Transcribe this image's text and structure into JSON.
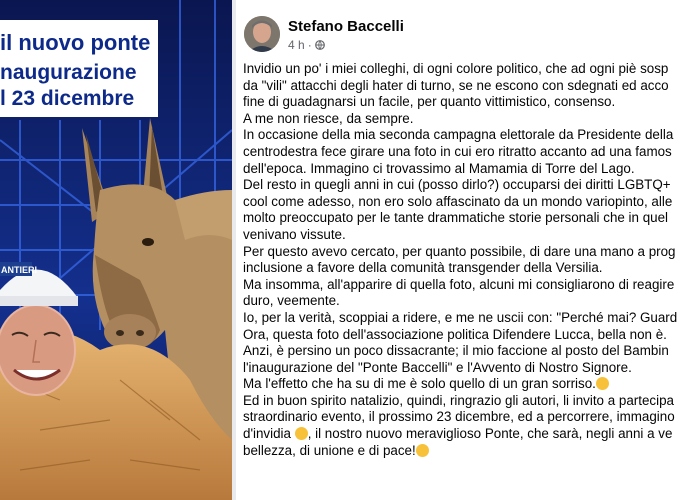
{
  "image": {
    "banner_lines": [
      "il nuovo ponte",
      "naugurazione",
      "l 23 dicembre"
    ],
    "helmet_text": "ANTIERI"
  },
  "post": {
    "author": "Stefano Baccelli",
    "time": "4 h",
    "privacy_icon": "globe-icon",
    "lines": [
      "Invidio un po' i miei colleghi, di ogni colore politico, che ad ogni piè sosp",
      "da \"vili\" attacchi degli hater di turno, se ne escono con sdegnati ed acco",
      "fine di guadagnarsi un facile, per quanto vittimistico, consenso.",
      "A me non riesce, da sempre.",
      "In occasione della mia seconda campagna elettorale da Presidente della",
      "centrodestra fece girare una foto in cui ero ritratto accanto ad una famos",
      "dell'epoca.  Immagino ci trovassimo al Mamamia di Torre del Lago.",
      "Del resto in quegli anni in cui (posso dirlo?) occuparsi dei diritti LGBTQ+",
      "cool come adesso, non ero solo affascinato da un mondo variopinto, alle",
      "molto preoccupato per le tante drammatiche storie personali che in quel",
      "venivano vissute.",
      "Per questo avevo cercato, per quanto possibile, di dare una mano a prog",
      "inclusione  a favore della comunità transgender della Versilia.",
      "Ma insomma, all'apparire di quella foto, alcuni mi consigliarono di reagire",
      "duro, veemente.",
      "Io, per la verità, scoppiai a ridere, e me ne uscii con: \"Perché mai? Guard",
      "Ora, questa foto dell'associazione politica Difendere Lucca, bella non è.",
      "Anzi, è persino un poco dissacrante; il mio faccione al posto del Bambin",
      "l'inaugurazione del \"Ponte Baccelli\" e l'Avvento di Nostro Signore.",
      "Ma l'effetto che ha su di me è solo quello di un gran sorriso.",
      "Ed in buon spirito natalizio, quindi, ringrazio gli autori, li invito a partecipa",
      "straordinario evento, il prossimo 23 dicembre, ed a percorrere, immagino",
      "d'invidia , il nostro nuovo meraviglioso Ponte, che sarà, negli anni a ve",
      "bellezza, di unione e di pace!"
    ]
  }
}
